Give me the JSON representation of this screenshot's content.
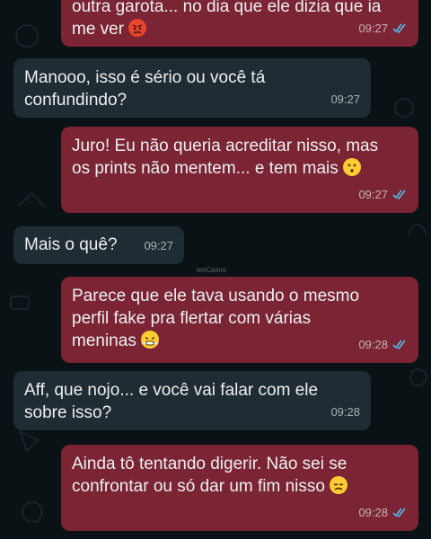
{
  "messages": [
    {
      "id": "m1",
      "direction": "outgoing",
      "text": "outra garota... no dia que ele dizia que ia",
      "text2": "me ver",
      "emoji": "angry-face-emoji",
      "time": "09:27",
      "read": true
    },
    {
      "id": "m2",
      "direction": "incoming",
      "text": "Manooo, isso é sério ou você tá\nconfundindo?",
      "time": "09:27"
    },
    {
      "id": "m3",
      "direction": "outgoing",
      "text": "Juro! Eu não queria acreditar nisso, mas\nos prints não mentem... e tem mais",
      "emoji": "hushed-face-emoji",
      "time": "09:27",
      "read": true
    },
    {
      "id": "m4",
      "direction": "incoming",
      "text": "Mais o quê?",
      "time": "09:27"
    },
    {
      "id": "m5",
      "direction": "outgoing",
      "text": "Parece que ele tava usando o mesmo\nperfil fake pra flertar com várias\nmeninas",
      "emoji": "steam-face-emoji",
      "time": "09:28",
      "read": true
    },
    {
      "id": "m6",
      "direction": "incoming",
      "text": "Aff, que nojo... e você vai falar com ele\nsobre isso?",
      "time": "09:28"
    },
    {
      "id": "m7",
      "direction": "outgoing",
      "text": "Ainda tô tentando digerir. Não sei se\nconfrontar ou só dar um fim nisso",
      "emoji": "disappointed-face-emoji",
      "time": "09:28",
      "read": true
    }
  ],
  "watermark": "iesCasos",
  "colors": {
    "outgoing_bubble": "#7a2434",
    "incoming_bubble": "#202c33",
    "read_ticks": "#53bdeb",
    "background": "#0b1216"
  }
}
